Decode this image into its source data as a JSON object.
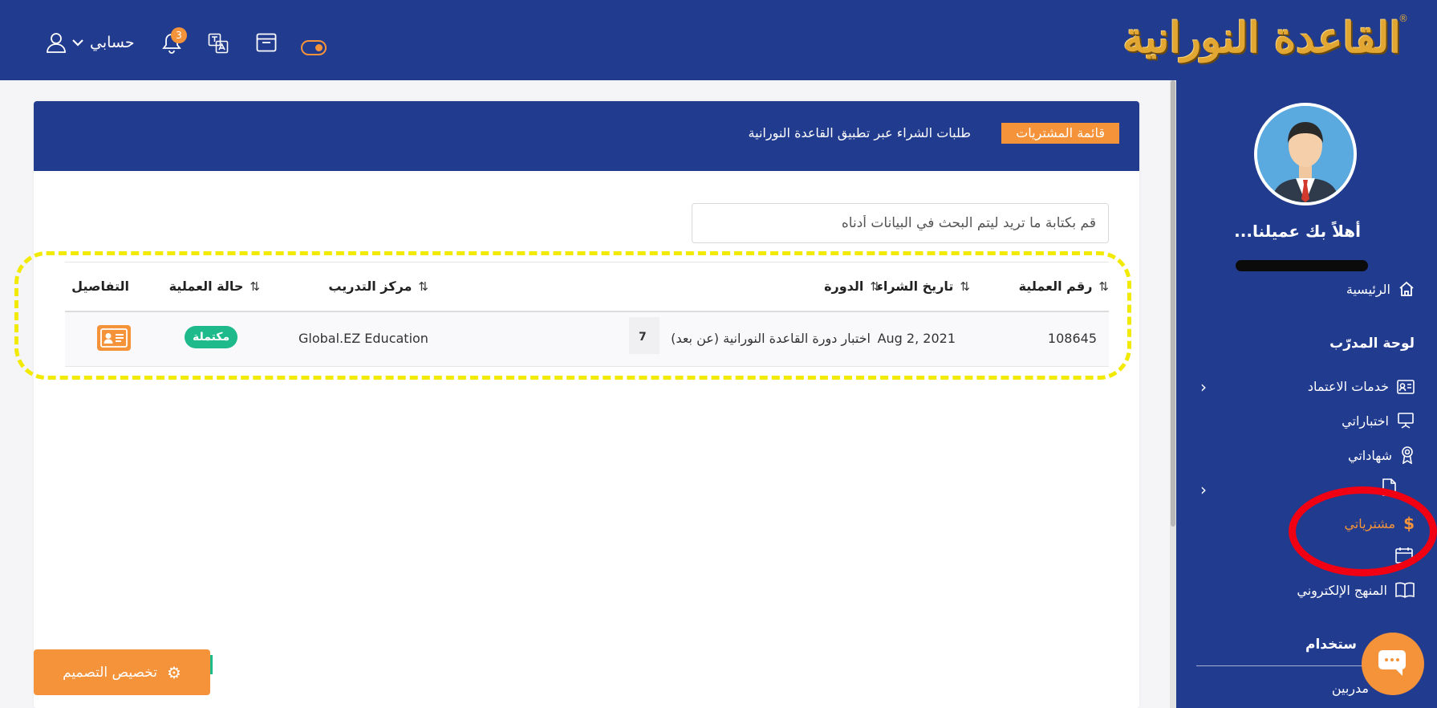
{
  "header": {
    "logo_text": "القاعدة النورانية",
    "logo_reg": "®",
    "account_label": "حسابي",
    "notification_count": "3"
  },
  "sidebar": {
    "welcome": "أهلاً بك عميلنا...",
    "home": "الرئيسية",
    "dashboard_heading": "لوحة المدرّب",
    "items": [
      {
        "label": "خدمات الاعتماد",
        "icon": "id-card-icon"
      },
      {
        "label": "اختباراتي",
        "icon": "presentation-icon"
      },
      {
        "label": "شهاداتي",
        "icon": "award-icon"
      },
      {
        "label": "مشترياتي",
        "icon": "dollar-icon"
      },
      {
        "label": "المنهج الإلكتروني",
        "icon": "book-icon"
      }
    ],
    "section2_heading": "ستخدام",
    "bottom_item": "مدربين"
  },
  "card": {
    "chip": "قائمة المشتريات",
    "title": "طلبات الشراء عبر تطبيق القاعدة النورانية"
  },
  "search": {
    "placeholder": "قم بكتابة ما تريد ليتم البحث في البيانات أدناه"
  },
  "table": {
    "columns": [
      "رقم العملية",
      "تاريخ الشراء",
      "الدورة",
      "مركز التدريب",
      "حالة العملية",
      "التفاصيل"
    ],
    "rows": [
      {
        "id": "108645",
        "date": "Aug 2, 2021",
        "course": "اختبار دورة القاعدة النورانية (عن بعد)",
        "course_extra": "7",
        "center": "Global.EZ Education",
        "status": "مكتملة"
      }
    ]
  },
  "customize_button": "تخصيص التصميم",
  "colors": {
    "primary": "#213b8f",
    "accent": "#f4933a",
    "success": "#1fba8c",
    "highlight_dash": "#f2ea00",
    "annotation_red": "#f00012"
  }
}
